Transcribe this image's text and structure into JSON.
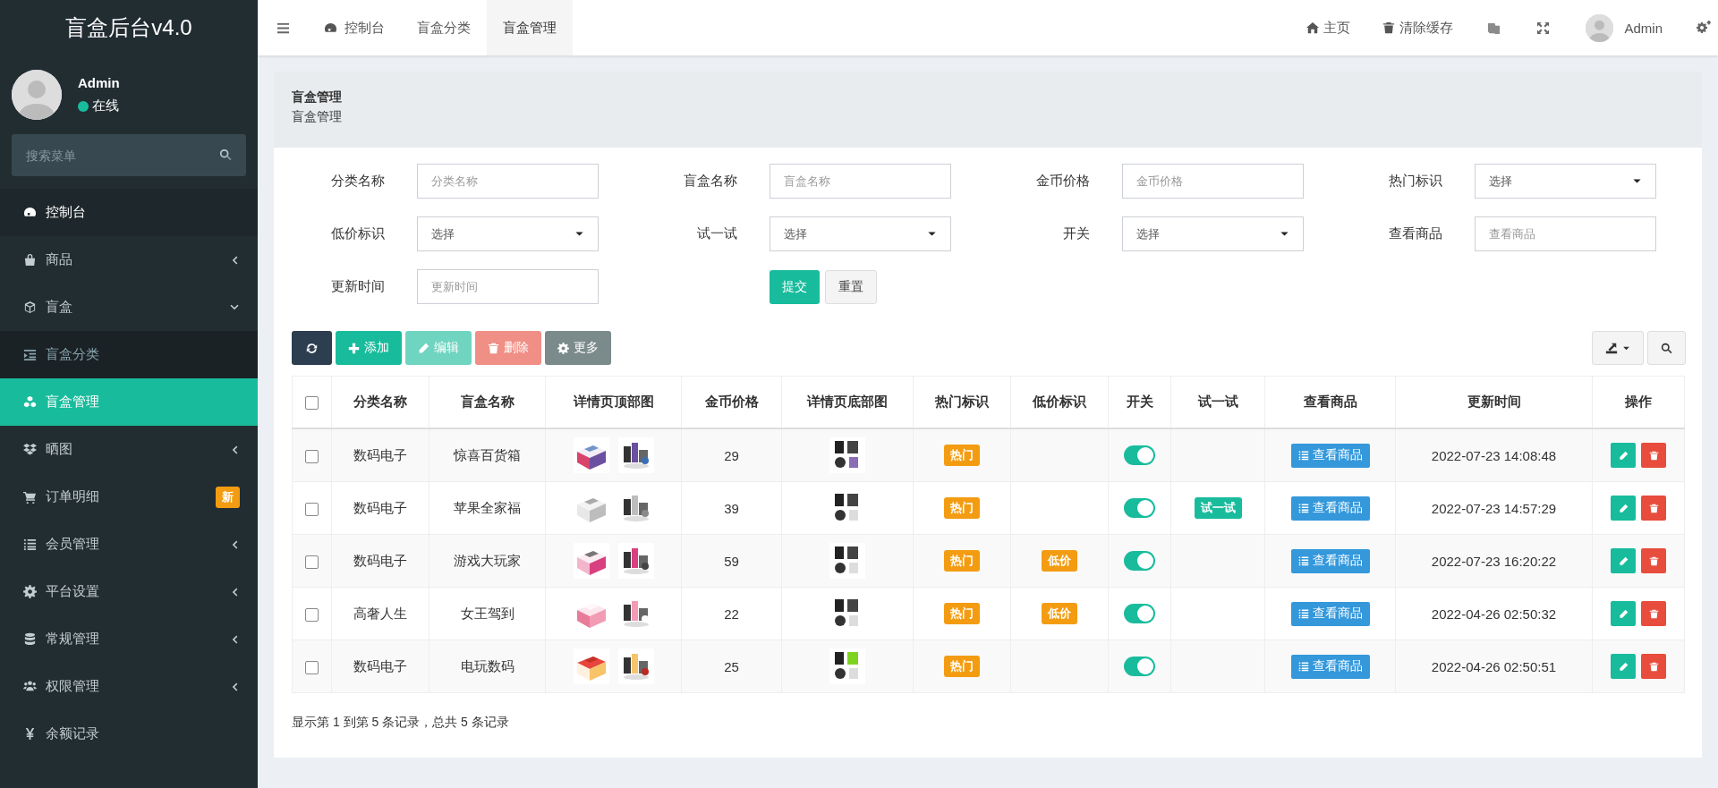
{
  "sidebar": {
    "logo": "盲盒后台v4.0",
    "user": {
      "name": "Admin",
      "status": "在线"
    },
    "search": {
      "placeholder": "搜索菜单"
    },
    "items": [
      {
        "label": "控制台",
        "selected": false
      },
      {
        "label": "商品",
        "selected": false,
        "expanded": false
      },
      {
        "label": "盲盒",
        "selected": false,
        "expanded": true,
        "children": [
          {
            "label": "盲盒分类",
            "selected": false
          },
          {
            "label": "盲盒管理",
            "selected": true
          }
        ]
      },
      {
        "label": "晒图",
        "selected": false,
        "expanded": false
      },
      {
        "label": "订单明细",
        "selected": false,
        "badge": "新"
      },
      {
        "label": "会员管理",
        "selected": false,
        "expanded": false
      },
      {
        "label": "平台设置",
        "selected": false,
        "expanded": false
      },
      {
        "label": "常规管理",
        "selected": false,
        "expanded": false
      },
      {
        "label": "权限管理",
        "selected": false,
        "expanded": false
      },
      {
        "label": "余额记录",
        "selected": false
      }
    ]
  },
  "topbar": {
    "tabs": [
      {
        "label": "控制台",
        "selected": false
      },
      {
        "label": "盲盒分类",
        "selected": false
      },
      {
        "label": "盲盒管理",
        "selected": true
      }
    ],
    "links": [
      {
        "label": "主页"
      },
      {
        "label": "清除缓存"
      }
    ],
    "user": "Admin"
  },
  "page_header": {
    "title": "盲盒管理",
    "subtitle": "盲盒管理"
  },
  "filters": [
    {
      "label": "分类名称",
      "kind": "input",
      "placeholder": "分类名称"
    },
    {
      "label": "盲盒名称",
      "kind": "input",
      "placeholder": "盲盒名称"
    },
    {
      "label": "金币价格",
      "kind": "input",
      "placeholder": "金币价格"
    },
    {
      "label": "热门标识",
      "kind": "select",
      "value": "选择"
    },
    {
      "label": "低价标识",
      "kind": "select",
      "value": "选择"
    },
    {
      "label": "试一试",
      "kind": "select",
      "value": "选择"
    },
    {
      "label": "开关",
      "kind": "select",
      "value": "选择"
    },
    {
      "label": "查看商品",
      "kind": "input",
      "placeholder": "查看商品"
    },
    {
      "label": "更新时间",
      "kind": "input",
      "placeholder": "更新时间"
    }
  ],
  "form_buttons": [
    "提交",
    "重置"
  ],
  "toolbar": [
    {
      "kind": "refresh",
      "disabled": false
    },
    {
      "kind": "add",
      "label": "添加",
      "disabled": false
    },
    {
      "kind": "edit",
      "label": "编辑",
      "disabled": true
    },
    {
      "kind": "delete",
      "label": "删除",
      "disabled": true
    },
    {
      "kind": "more",
      "label": "更多",
      "disabled": false
    }
  ],
  "table": {
    "header_checked": false,
    "columns": [
      "分类名称",
      "盲盒名称",
      "详情页顶部图",
      "金币价格",
      "详情页底部图",
      "热门标识",
      "低价标识",
      "开关",
      "试一试",
      "查看商品",
      "更新时间",
      "操作"
    ],
    "rows": [
      {
        "checked": false,
        "category": "数码电子",
        "name": "惊喜百货箱",
        "price": "29",
        "hot": "热门",
        "on": true,
        "view": "查看商品",
        "updated": "2022-07-23 14:08:48"
      },
      {
        "checked": false,
        "category": "数码电子",
        "name": "苹果全家福",
        "price": "39",
        "hot": "热门",
        "on": true,
        "trial": "试一试",
        "view": "查看商品",
        "updated": "2022-07-23 14:57:29"
      },
      {
        "checked": false,
        "category": "数码电子",
        "name": "游戏大玩家",
        "price": "59",
        "hot": "热门",
        "low": "低价",
        "on": true,
        "view": "查看商品",
        "updated": "2022-07-23 16:20:22"
      },
      {
        "checked": false,
        "category": "高奢人生",
        "name": "女王驾到",
        "price": "22",
        "hot": "热门",
        "low": "低价",
        "on": true,
        "view": "查看商品",
        "updated": "2022-04-26 02:50:32"
      },
      {
        "checked": false,
        "category": "数码电子",
        "name": "电玩数码",
        "price": "25",
        "hot": "热门",
        "on": true,
        "view": "查看商品",
        "updated": "2022-04-26 02:50:51"
      }
    ]
  },
  "footer": "显示第 1 到第 5 条记录，总共 5 条记录"
}
